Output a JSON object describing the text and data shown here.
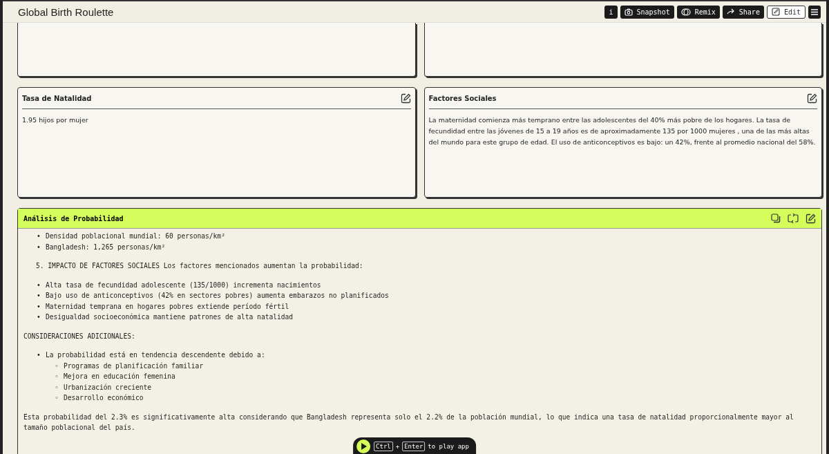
{
  "app_title": "Global Birth Roulette",
  "toolbar": [
    {
      "kind": "info",
      "label": "i"
    },
    {
      "kind": "snapshot",
      "label": "Snapshot"
    },
    {
      "kind": "remix",
      "label": "Remix"
    },
    {
      "kind": "share",
      "label": "Share"
    },
    {
      "kind": "edit",
      "label": "Edit"
    },
    {
      "kind": "menu"
    }
  ],
  "cards": [
    {
      "title": "Tasa de Natalidad",
      "body": "1.95 hijos por mujer"
    },
    {
      "title": "Factores Sociales",
      "body": "La maternidad comienza más temprano entre las adolescentes del 40% más pobre de los hogares. La tasa de fecundidad entre las jóvenes de 15 a 19 años es de aproximadamente 135 por 1000 mujeres , una de las más altas del mundo para este grupo de edad. El uso de anticonceptivos es bajo: un 42%, frente al promedio nacional del 58%."
    }
  ],
  "analysis": {
    "title": "Análisis de Probabilidad",
    "blocks": [
      {
        "kind": "bullets",
        "items": [
          {
            "marker": "•",
            "text": "Densidad poblacional mundial: 60 personas/km²"
          },
          {
            "marker": "•",
            "text": "Bangladesh: 1,265 personas/km²"
          }
        ]
      },
      {
        "kind": "numbered",
        "number": "5.",
        "text": "IMPACTO DE FACTORES SOCIALES Los factores mencionados aumentan la probabilidad:"
      },
      {
        "kind": "bullets",
        "items": [
          {
            "marker": "•",
            "text": "Alta tasa de fecundidad adolescente (135/1000) incrementa nacimientos"
          },
          {
            "marker": "•",
            "text": "Bajo uso de anticonceptivos (42% en sectores pobres) aumenta embarazos no planificados"
          },
          {
            "marker": "•",
            "text": "Maternidad temprana en hogares pobres extiende período fértil"
          },
          {
            "marker": "•",
            "text": "Desigualdad socioeconómica mantiene patrones de alta natalidad"
          }
        ]
      },
      {
        "kind": "paragraph",
        "text": "CONSIDERACIONES ADICIONALES:"
      },
      {
        "kind": "bullets",
        "items": [
          {
            "marker": "•",
            "text": "La probabilidad está en tendencia descendente debido a:",
            "children": [
              {
                "marker": "◦",
                "text": "Programas de planificación familiar"
              },
              {
                "marker": "◦",
                "text": "Mejora en educación femenina"
              },
              {
                "marker": "◦",
                "text": "Urbanización creciente"
              },
              {
                "marker": "◦",
                "text": "Desarrollo económico"
              }
            ]
          }
        ]
      },
      {
        "kind": "paragraph",
        "text": "Esta probabilidad del 2.3% es significativamente alta considerando que Bangladesh representa solo el 2.2% de la población mundial, lo que indica una tasa de natalidad proporcionalmente mayor al tamaño poblacional del país."
      }
    ]
  },
  "play_bar": {
    "keys": [
      "Ctrl",
      "Enter"
    ],
    "joiner": "+",
    "hint": "to play app"
  }
}
